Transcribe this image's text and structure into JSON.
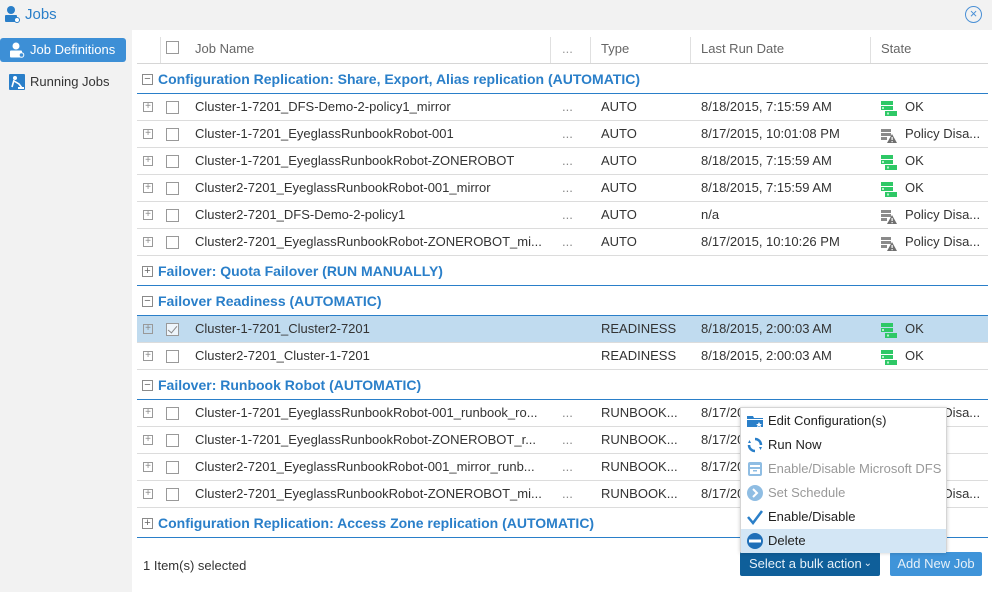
{
  "window": {
    "title": "Jobs",
    "close_icon": "close-circle-icon"
  },
  "sidebar": {
    "items": [
      {
        "label": "Job Definitions",
        "icon": "job-definitions-icon",
        "active": true
      },
      {
        "label": "Running Jobs",
        "icon": "running-jobs-icon",
        "active": false
      }
    ]
  },
  "table": {
    "columns": {
      "name": "Job Name",
      "more": "...",
      "type": "Type",
      "last_run": "Last Run Date",
      "state": "State"
    },
    "groups": [
      {
        "label": "Configuration Replication: Share, Export, Alias replication (AUTOMATIC)",
        "expanded": true,
        "rows": [
          {
            "name": "Cluster-1-7201_DFS-Demo-2-policy1_mirror",
            "more": "...",
            "type": "AUTO",
            "last_run": "8/18/2015, 7:15:59 AM",
            "state": "OK",
            "state_icon": "ok"
          },
          {
            "name": "Cluster-1-7201_EyeglassRunbookRobot-001",
            "more": "...",
            "type": "AUTO",
            "last_run": "8/17/2015, 10:01:08 PM",
            "state": "Policy Disa...",
            "state_icon": "warning"
          },
          {
            "name": "Cluster-1-7201_EyeglassRunbookRobot-ZONEROBOT",
            "more": "...",
            "type": "AUTO",
            "last_run": "8/18/2015, 7:15:59 AM",
            "state": "OK",
            "state_icon": "ok"
          },
          {
            "name": "Cluster2-7201_EyeglassRunbookRobot-001_mirror",
            "more": "...",
            "type": "AUTO",
            "last_run": "8/18/2015, 7:15:59 AM",
            "state": "OK",
            "state_icon": "ok"
          },
          {
            "name": "Cluster2-7201_DFS-Demo-2-policy1",
            "more": "...",
            "type": "AUTO",
            "last_run": "n/a",
            "state": "Policy Disa...",
            "state_icon": "warning"
          },
          {
            "name": "Cluster2-7201_EyeglassRunbookRobot-ZONEROBOT_mi...",
            "more": "...",
            "type": "AUTO",
            "last_run": "8/17/2015, 10:10:26 PM",
            "state": "Policy Disa...",
            "state_icon": "warning"
          }
        ]
      },
      {
        "label": "Failover: Quota Failover (RUN MANUALLY)",
        "expanded": false,
        "rows": []
      },
      {
        "label": "Failover Readiness (AUTOMATIC)",
        "expanded": true,
        "rows": [
          {
            "name": "Cluster-1-7201_Cluster2-7201",
            "more": "",
            "type": "READINESS",
            "last_run": "8/18/2015, 2:00:03 AM",
            "state": "OK",
            "state_icon": "ok",
            "selected": true
          },
          {
            "name": "Cluster2-7201_Cluster-1-7201",
            "more": "",
            "type": "READINESS",
            "last_run": "8/18/2015, 2:00:03 AM",
            "state": "OK",
            "state_icon": "ok"
          }
        ]
      },
      {
        "label": "Failover: Runbook Robot (AUTOMATIC)",
        "expanded": true,
        "rows": [
          {
            "name": "Cluster-1-7201_EyeglassRunbookRobot-001_runbook_ro...",
            "more": "...",
            "type": "RUNBOOK...",
            "last_run": "8/17/20",
            "state": "Policy Disa...",
            "state_icon": "warning"
          },
          {
            "name": "Cluster-1-7201_EyeglassRunbookRobot-ZONEROBOT_r...",
            "more": "...",
            "type": "RUNBOOK...",
            "last_run": "8/17/20",
            "state": "",
            "state_icon": ""
          },
          {
            "name": "Cluster2-7201_EyeglassRunbookRobot-001_mirror_runb...",
            "more": "...",
            "type": "RUNBOOK...",
            "last_run": "8/17/20",
            "state": "",
            "state_icon": ""
          },
          {
            "name": "Cluster2-7201_EyeglassRunbookRobot-ZONEROBOT_mi...",
            "more": "...",
            "type": "RUNBOOK...",
            "last_run": "8/17/20",
            "state": "Policy Disa...",
            "state_icon": "warning"
          }
        ]
      },
      {
        "label": "Configuration Replication: Access Zone replication (AUTOMATIC)",
        "expanded": false,
        "rows": []
      }
    ]
  },
  "footer": {
    "selected_count": "1 Item(s) selected",
    "bulk_action_label": "Select a bulk action",
    "add_job_label": "Add New Job"
  },
  "bulk_menu": {
    "items": [
      {
        "label": "Edit Configuration(s)",
        "icon": "edit-folder-icon",
        "disabled": false
      },
      {
        "label": "Run Now",
        "icon": "run-now-icon",
        "disabled": false
      },
      {
        "label": "Enable/Disable Microsoft DFS",
        "icon": "dfs-icon",
        "disabled": true
      },
      {
        "label": "Set Schedule",
        "icon": "schedule-chevron-icon",
        "disabled": true
      },
      {
        "label": "Enable/Disable",
        "icon": "checkmark-icon",
        "disabled": false
      },
      {
        "label": "Delete",
        "icon": "delete-minus-icon",
        "disabled": false,
        "hover": true
      }
    ]
  },
  "colors": {
    "accent": "#2a7fc9",
    "selected_row": "#c0dbef",
    "ok_green": "#2ec866",
    "bulk_button": "#0f5f9a",
    "add_button": "#3f94d9"
  }
}
